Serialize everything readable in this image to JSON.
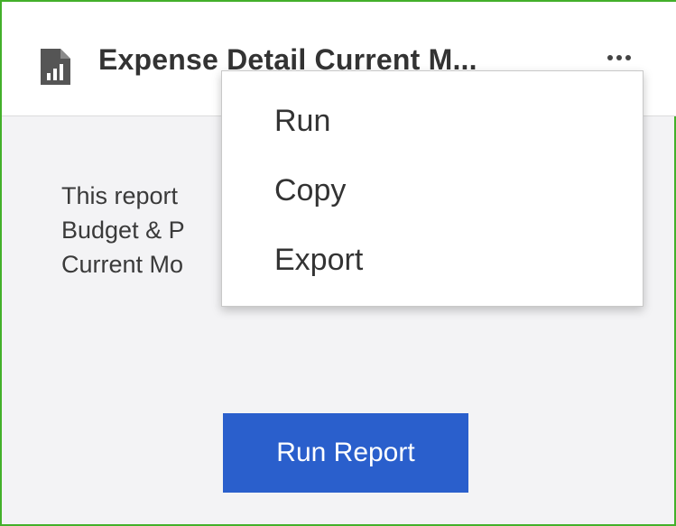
{
  "card": {
    "title": "Expense Detail Current M...",
    "icon": "report-chart-icon",
    "more_icon": "ellipsis-icon",
    "description_lines": [
      "This report",
      "Budget & P",
      "Current Mo"
    ],
    "run_report_label": "Run Report"
  },
  "context_menu": {
    "items": [
      {
        "label": "Run"
      },
      {
        "label": "Copy"
      },
      {
        "label": "Export"
      }
    ]
  },
  "colors": {
    "border_accent": "#43b02a",
    "primary_button": "#2a5fcc",
    "card_background": "#f3f3f5"
  }
}
